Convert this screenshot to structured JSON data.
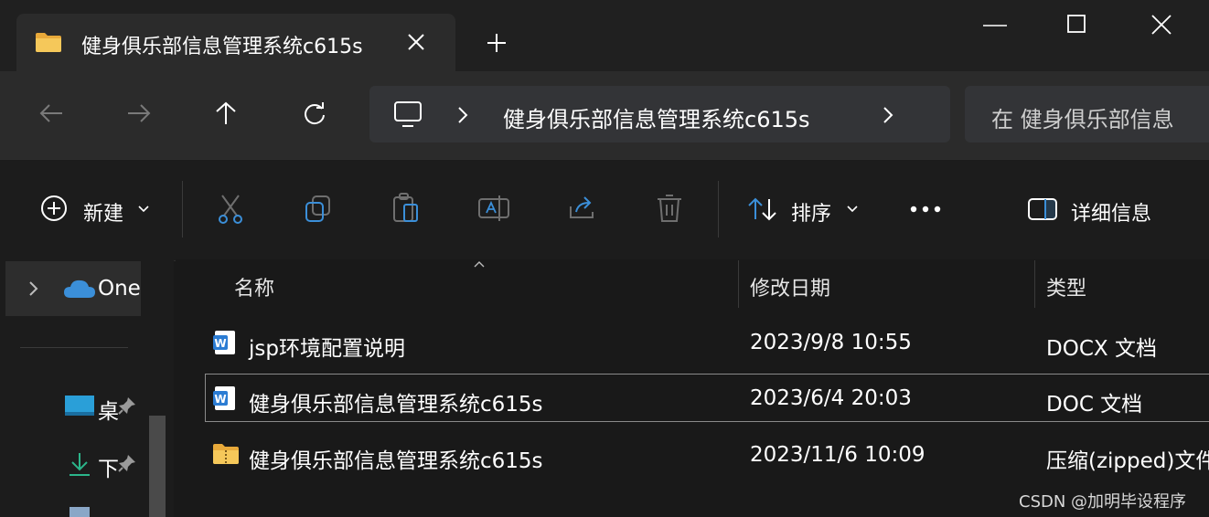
{
  "window": {
    "tab_title": "健身俱乐部信息管理系统c615s"
  },
  "address_bar": {
    "path": "健身俱乐部信息管理系统c615s",
    "search_placeholder": "在 健身俱乐部信息"
  },
  "toolbar": {
    "new_label": "新建",
    "sort_label": "排序",
    "details_label": "详细信息"
  },
  "sidebar": {
    "onedrive_label": "One",
    "desktop_label": "桌",
    "downloads_label": "下"
  },
  "columns": {
    "name": "名称",
    "modified": "修改日期",
    "type": "类型"
  },
  "files": [
    {
      "name": "jsp环境配置说明",
      "modified": "2023/9/8 10:55",
      "type": "DOCX 文档",
      "icon": "word-doc-icon"
    },
    {
      "name": "健身俱乐部信息管理系统c615s",
      "modified": "2023/6/4 20:03",
      "type": "DOC 文档",
      "icon": "word-doc-icon"
    },
    {
      "name": "健身俱乐部信息管理系统c615s",
      "modified": "2023/11/6 10:09",
      "type": "压缩(zipped)文件",
      "icon": "zip-folder-icon"
    }
  ],
  "watermark": "CSDN @加明毕设程序",
  "colors": {
    "accent_blue": "#3b8fd9",
    "folder_yellow": "#f2c14e",
    "background": "#191919"
  }
}
